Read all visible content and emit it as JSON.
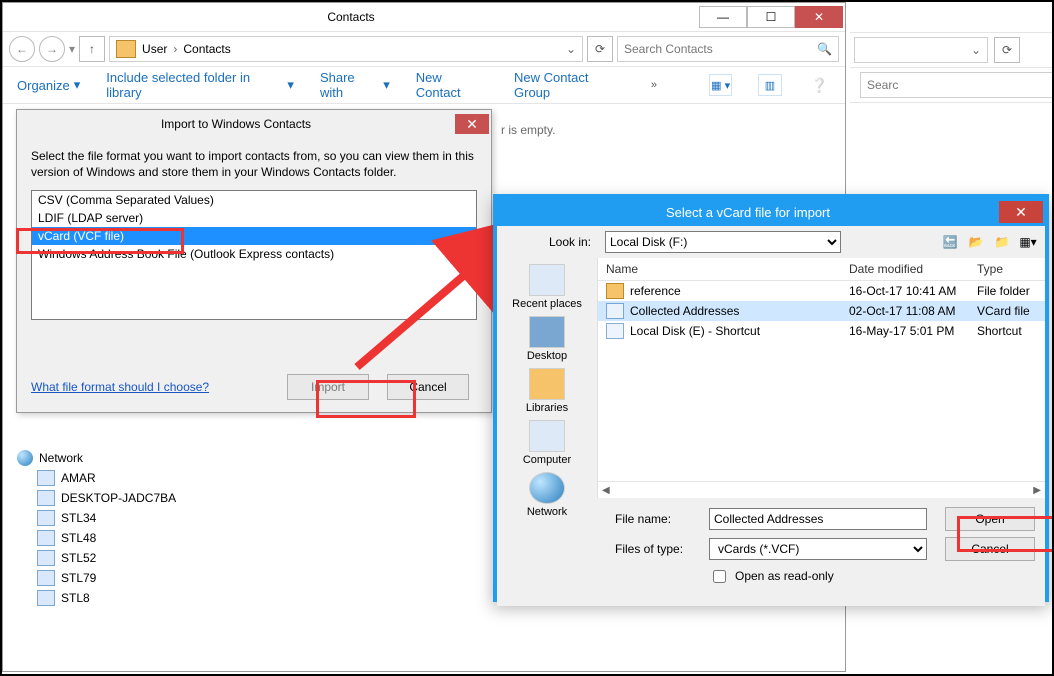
{
  "contacts_window": {
    "title": "Contacts",
    "breadcrumb": {
      "root": "User",
      "current": "Contacts"
    },
    "search_placeholder": "Search Contacts",
    "toolbar": {
      "organize": "Organize",
      "include": "Include selected folder in library",
      "share": "Share with",
      "new_contact": "New Contact",
      "new_group": "New Contact Group"
    },
    "empty_hint": "r is empty.",
    "tree": {
      "network": "Network",
      "nodes": [
        "AMAR",
        "DESKTOP-JADC7BA",
        "STL34",
        "STL48",
        "STL52",
        "STL79",
        "STL8"
      ]
    }
  },
  "import_dialog": {
    "title": "Import to Windows Contacts",
    "description": "Select the file format you want to import contacts from, so you can view them in this version of Windows and store them in your Windows Contacts folder.",
    "formats": [
      "CSV (Comma Separated Values)",
      "LDIF (LDAP server)",
      "vCard (VCF file)",
      "Windows Address Book File (Outlook Express contacts)"
    ],
    "selected_index": 2,
    "help_link": "What file format should I choose?",
    "import_btn": "Import",
    "cancel_btn": "Cancel"
  },
  "file_picker": {
    "title": "Select a vCard file for import",
    "look_in_label": "Look in:",
    "look_in_value": "Local Disk (F:)",
    "places": [
      "Recent places",
      "Desktop",
      "Libraries",
      "Computer",
      "Network"
    ],
    "columns": {
      "name": "Name",
      "date": "Date modified",
      "type": "Type"
    },
    "rows": [
      {
        "name": "reference",
        "date": "16-Oct-17 10:41 AM",
        "type": "File folder",
        "icon": "folder",
        "selected": false
      },
      {
        "name": "Collected Addresses",
        "date": "02-Oct-17 11:08 AM",
        "type": "VCard file",
        "icon": "card",
        "selected": true
      },
      {
        "name": "Local Disk (E) - Shortcut",
        "date": "16-May-17 5:01 PM",
        "type": "Shortcut",
        "icon": "short",
        "selected": false
      }
    ],
    "file_name_label": "File name:",
    "file_name_value": "Collected Addresses",
    "file_type_label": "Files of type:",
    "file_type_value": "vCards (*.VCF)",
    "readonly_label": "Open as read-only",
    "open_btn": "Open",
    "cancel_btn": "Cancel"
  },
  "right_sliver": {
    "search_hint": "Searc"
  }
}
